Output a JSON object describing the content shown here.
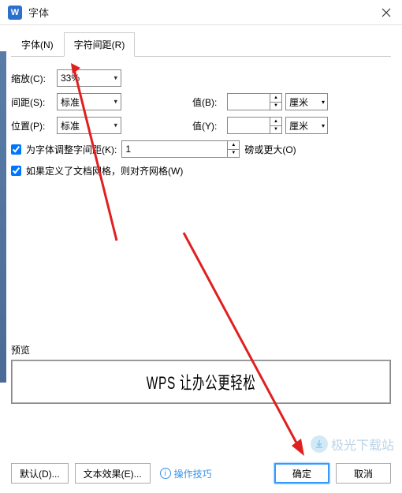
{
  "titlebar": {
    "icon_text": "W",
    "title": "字体"
  },
  "tabs": {
    "font": "字体(N)",
    "spacing": "字符间距(R)"
  },
  "rows": {
    "scale_label": "缩放(C):",
    "scale_value": "33%",
    "spacing_label": "间距(S):",
    "spacing_value": "标准",
    "spacing_val_label": "值(B):",
    "spacing_val_value": "",
    "spacing_unit": "厘米",
    "position_label": "位置(P):",
    "position_value": "标准",
    "position_val_label": "值(Y):",
    "position_val_value": "",
    "position_unit": "厘米"
  },
  "check1": {
    "label": "为字体调整字间距(K):",
    "value": "1",
    "suffix": "磅或更大(O)"
  },
  "check2": {
    "label": "如果定义了文档网格，则对齐网格(W)"
  },
  "preview": {
    "label": "预览",
    "text": "WPS 让办公更轻松"
  },
  "footer": {
    "default_btn": "默认(D)...",
    "text_effect_btn": "文本效果(E)...",
    "hint": "操作技巧",
    "ok": "确定",
    "cancel": "取消"
  },
  "watermark": "极光下载站"
}
